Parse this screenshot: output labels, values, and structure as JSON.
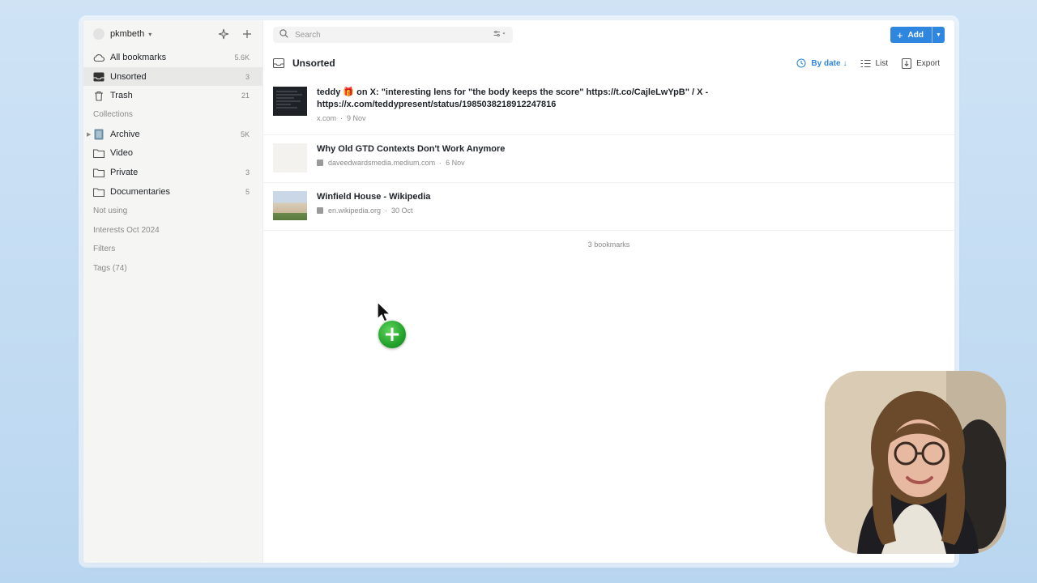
{
  "colors": {
    "accent": "#2f86de",
    "drag_plus": "#23a32b"
  },
  "sidebar": {
    "user": "pkmbeth",
    "items": [
      {
        "label": "All bookmarks",
        "count": "5.6K",
        "icon": "cloud-icon"
      },
      {
        "label": "Unsorted",
        "count": "3",
        "icon": "inbox-icon",
        "active": true
      },
      {
        "label": "Trash",
        "count": "21",
        "icon": "trash-icon"
      }
    ],
    "collections_label": "Collections",
    "collections": [
      {
        "label": "Archive",
        "count": "5K",
        "icon": "archive-icon"
      },
      {
        "label": "Video",
        "count": "",
        "icon": "folder-icon"
      },
      {
        "label": "Private",
        "count": "3",
        "icon": "folder-icon"
      },
      {
        "label": "Documentaries",
        "count": "5",
        "icon": "folder-icon"
      }
    ],
    "groups": [
      "Not using",
      "Interests Oct 2024"
    ],
    "filters_label": "Filters",
    "tags_label": "Tags (74)"
  },
  "search": {
    "placeholder": "Search"
  },
  "toolbar": {
    "add_label": "Add"
  },
  "header": {
    "title": "Unsorted",
    "sort_label": "By date",
    "view_label": "List",
    "export_label": "Export"
  },
  "bookmarks": [
    {
      "title": "teddy 🎁 on X: \"interesting lens for \"the body keeps the score\" https://t.co/CajleLwYpB\" / X - https://x.com/teddypresent/status/1985038218912247816",
      "domain": "x.com",
      "date": "9 Nov"
    },
    {
      "title": "Why Old GTD Contexts Don't Work Anymore",
      "domain": "daveedwardsmedia.medium.com",
      "date": "6 Nov"
    },
    {
      "title": "Winfield House - Wikipedia",
      "domain": "en.wikipedia.org",
      "date": "30 Oct"
    }
  ],
  "footer": {
    "count_label": "3 bookmarks"
  }
}
